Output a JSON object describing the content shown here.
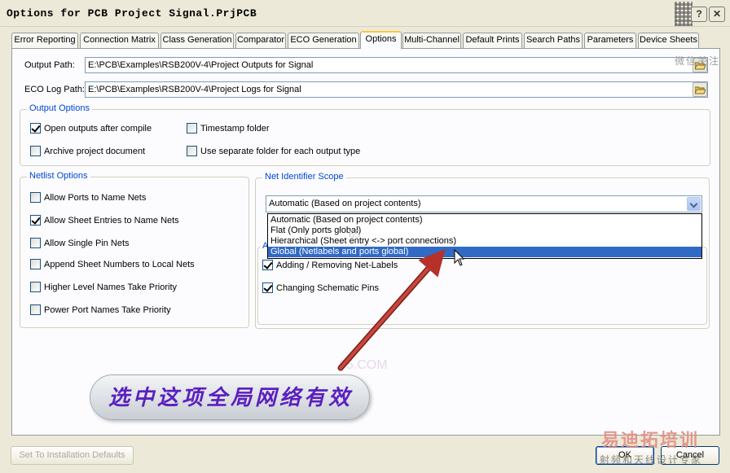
{
  "window": {
    "title": "Options for PCB Project Signal.PrjPCB",
    "help_label": "?",
    "close_label": "✕"
  },
  "tabs": [
    {
      "label": "Error Reporting"
    },
    {
      "label": "Connection Matrix"
    },
    {
      "label": "Class Generation"
    },
    {
      "label": "Comparator"
    },
    {
      "label": "ECO Generation"
    },
    {
      "label": "Options",
      "active": true
    },
    {
      "label": "Multi-Channel"
    },
    {
      "label": "Default Prints"
    },
    {
      "label": "Search Paths"
    },
    {
      "label": "Parameters"
    },
    {
      "label": "Device Sheets"
    }
  ],
  "paths": {
    "output_label": "Output Path:",
    "output_value": "E:\\PCB\\Examples\\RSB200V-4\\Project Outputs for Signal",
    "eco_label": "ECO Log Path:",
    "eco_value": "E:\\PCB\\Examples\\RSB200V-4\\Project Logs for Signal"
  },
  "output_options": {
    "legend": "Output Options",
    "open_outputs": {
      "label": "Open outputs after compile",
      "checked": true
    },
    "timestamp_folder": {
      "label": "Timestamp folder",
      "checked": false
    },
    "archive_document": {
      "label": "Archive project document",
      "checked": false
    },
    "separate_folder": {
      "label": "Use separate folder for each output type",
      "checked": false
    }
  },
  "netlist_options": {
    "legend": "Netlist Options",
    "items": [
      {
        "label": "Allow Ports to Name Nets",
        "checked": false
      },
      {
        "label": "Allow Sheet Entries to Name Nets",
        "checked": true
      },
      {
        "label": "Allow Single Pin Nets",
        "checked": false
      },
      {
        "label": "Append Sheet Numbers to Local Nets",
        "checked": false
      },
      {
        "label": "Higher Level Names Take Priority",
        "checked": false
      },
      {
        "label": "Power Port Names Take Priority",
        "checked": false
      }
    ]
  },
  "net_identifier": {
    "legend": "Net Identifier Scope",
    "selected": "Automatic (Based on project contents)",
    "options": [
      "Automatic (Based on project contents)",
      "Flat (Only ports global)",
      "Hierarchical (Sheet entry <-> port connections)",
      "Global (Netlabels and ports global)"
    ],
    "highlighted_index": 3
  },
  "allow_changes": {
    "legend": "A",
    "adding_removing": {
      "label": "Adding / Removing Net-Labels",
      "checked": true
    },
    "changing_pins": {
      "label": "Changing Schematic Pins",
      "checked": true
    }
  },
  "buttons": {
    "defaults": "Set To Installation Defaults",
    "ok": "OK",
    "cancel": "Cancel"
  },
  "annotation": {
    "callout_text": "选中这项全局网络有效",
    "arrow_color": "#b5312a"
  },
  "watermarks": {
    "url_fragment": "65",
    "url_mid": "65.COM",
    "side": "微信关注",
    "brand": "易迪拓培训",
    "brand_sub": "射频和天线设计专家"
  }
}
